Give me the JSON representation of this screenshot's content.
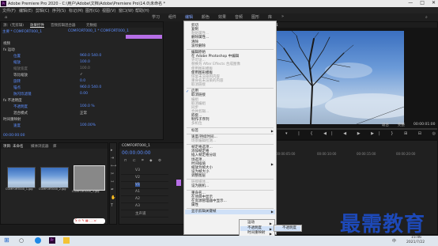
{
  "titlebar": {
    "title": "Adobe Premiere Pro 2020 - C:\\用户\\Adobe\\文档\\Adobe\\Premiere Pro\\14.0\\未命名 *",
    "logo": "Pr",
    "controls": [
      "—",
      "□",
      "✕"
    ]
  },
  "menubar": {
    "items": [
      "文件(F)",
      "编辑(E)",
      "剪辑(C)",
      "序列(S)",
      "标记(M)",
      "图形(G)",
      "视图(V)",
      "窗口(W)",
      "帮助(H)"
    ]
  },
  "workspaces": {
    "items": [
      "学习",
      "组件",
      "编辑",
      "颜色",
      "效果",
      "音频",
      "图形",
      "库"
    ],
    "active_index": 2,
    "more": "»"
  },
  "effect_controls": {
    "tabs": [
      "源：(无剪辑)",
      "效果控件",
      "音频剪辑混合器",
      "元数据"
    ],
    "source": "主要 * COMFORT000_1",
    "sequence": "COMFORT000_1 * COMFORT000_1",
    "sections": [
      {
        "label": "视频",
        "color": "#c8c8c8"
      },
      {
        "label": "fx 运动",
        "color": "#c8c8c8"
      },
      {
        "label": "位置",
        "value": "960.0  540.0",
        "color": "#5c8dff"
      },
      {
        "label": "缩放",
        "value": "100.0",
        "color": "#5c8dff"
      },
      {
        "label": "缩放宽度",
        "value": "100.0",
        "color": "#777"
      },
      {
        "label": "等比缩放",
        "value": "✓",
        "color": "#c8c8c8"
      },
      {
        "label": "旋转",
        "value": "0.0",
        "color": "#5c8dff"
      },
      {
        "label": "锚点",
        "value": "960.0  540.0",
        "color": "#5c8dff"
      },
      {
        "label": "防闪烁滤镜",
        "value": "0.00",
        "color": "#5c8dff"
      },
      {
        "label": "fx 不透明度",
        "color": "#c8c8c8"
      },
      {
        "label": "不透明度",
        "value": "100.0 %",
        "color": "#5c8dff"
      },
      {
        "label": "混合模式",
        "value": "正常",
        "color": "#c8c8c8"
      },
      {
        "label": "时间重映射",
        "color": "#c8c8c8"
      },
      {
        "label": "速度",
        "value": "100.00%",
        "color": "#5c8dff"
      }
    ],
    "timecode": "00:00:00:00"
  },
  "project": {
    "tabs": [
      "项目: 未命名",
      "媒体浏览器",
      "库"
    ],
    "items": [
      {
        "name": "COMFORT000_1.jpg",
        "duration": "5:00"
      },
      {
        "name": "COMFORT000_2.jpg",
        "duration": "5:00"
      },
      {
        "name": "COMFORT000_3.jpg",
        "duration": "5:00"
      }
    ]
  },
  "program": {
    "title": "节目: COMFORT000_1",
    "timecode_left": "00:00:00:00",
    "fit": "适合",
    "quality": "完整",
    "timecode_right": "00:00:01:00"
  },
  "timeline": {
    "tab": "COMFORT000_1",
    "timecode": "00:00:00:00",
    "tracks": [
      "V3",
      "V2",
      "V1",
      "A1",
      "A2",
      "A3",
      "主声道"
    ],
    "ruler": [
      "00:00",
      "00:00:05:00",
      "00:00:10:00",
      "00:00:15:00",
      "00:00:20:00"
    ],
    "master_value": "0.0"
  },
  "context_menu": {
    "items": [
      {
        "label": "剪切",
        "enabled": true
      },
      {
        "label": "复制",
        "enabled": true
      },
      {
        "label": "粘贴属性...",
        "enabled": false
      },
      {
        "label": "删除属性...",
        "enabled": true
      },
      {
        "label": "清除",
        "enabled": true
      },
      {
        "label": "波纹删除",
        "enabled": true
      },
      {
        "sep": true
      },
      {
        "label": "编辑原始",
        "enabled": true
      },
      {
        "label": "在 Adobe Photoshop 中编辑",
        "enabled": true
      },
      {
        "label": "许可证...",
        "enabled": false
      },
      {
        "label": "替换为 After Effects 合成图像",
        "enabled": false
      },
      {
        "label": "使用图形模板",
        "enabled": false
      },
      {
        "label": "使用图形模板",
        "enabled": true
      },
      {
        "label": "恢复未渲染的内容",
        "enabled": false
      },
      {
        "label": "重命名未渲染的内容",
        "enabled": false
      },
      {
        "label": "取消链接",
        "enabled": false
      },
      {
        "sep": true
      },
      {
        "label": "启用",
        "enabled": true,
        "checked": true
      },
      {
        "label": "取消链接",
        "enabled": true
      },
      {
        "label": "编组",
        "enabled": false
      },
      {
        "label": "取消编组",
        "enabled": false
      },
      {
        "label": "同步",
        "enabled": false
      },
      {
        "label": "合并剪辑...",
        "enabled": false
      },
      {
        "label": "嵌套...",
        "enabled": true
      },
      {
        "label": "制作子序列",
        "enabled": true
      },
      {
        "label": "多机位",
        "enabled": false
      },
      {
        "sep": true
      },
      {
        "label": "标签",
        "enabled": true,
        "submenu": true
      },
      {
        "sep": true
      },
      {
        "label": "速度/持续时间...",
        "enabled": true
      },
      {
        "label": "场景编辑检测...",
        "enabled": false
      },
      {
        "sep": true
      },
      {
        "label": "帧定格选项...",
        "enabled": true
      },
      {
        "label": "添加帧定格",
        "enabled": true
      },
      {
        "label": "插入帧定格分段",
        "enabled": true
      },
      {
        "label": "场选项...",
        "enabled": true
      },
      {
        "label": "时间插值",
        "enabled": true,
        "submenu": true
      },
      {
        "label": "缩放为帧大小",
        "enabled": true
      },
      {
        "label": "设为帧大小",
        "enabled": true
      },
      {
        "label": "调整图层",
        "enabled": true
      },
      {
        "sep": true
      },
      {
        "label": "链接媒体...",
        "enabled": false
      },
      {
        "label": "设为脱机...",
        "enabled": true
      },
      {
        "sep": true
      },
      {
        "label": "重命名...",
        "enabled": true
      },
      {
        "label": "在项目中显示",
        "enabled": true
      },
      {
        "label": "在资源管理器中显示...",
        "enabled": true
      },
      {
        "label": "属性",
        "enabled": true
      },
      {
        "sep": true
      },
      {
        "label": "显示剪辑关键帧",
        "enabled": true,
        "submenu": true,
        "highlight": true
      }
    ]
  },
  "submenu1": {
    "items": [
      {
        "label": "运动",
        "submenu": true
      },
      {
        "label": "不透明度",
        "submenu": true,
        "highlight": true
      },
      {
        "label": "时间重映射",
        "submenu": true
      }
    ]
  },
  "submenu2": {
    "items": [
      {
        "label": "不透明度",
        "highlight": true
      }
    ]
  },
  "taskbar": {
    "time": "15:46",
    "date": "2021/7/22",
    "lang": "中"
  },
  "watermark": "最需教育",
  "colors": {
    "accent_blue": "#2a6cd6",
    "keyframe_blue": "#5c8dff",
    "clip_purple": "#b66ee6",
    "watermark": "#1d49b8"
  }
}
